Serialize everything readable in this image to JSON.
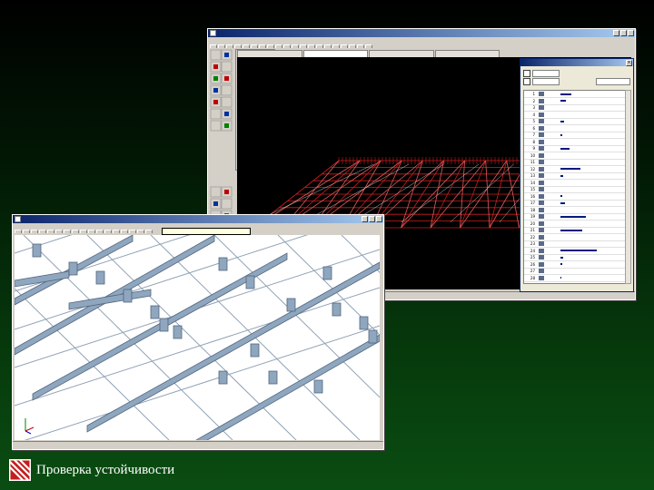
{
  "slide": {
    "caption": "Проверка устойчивости",
    "background_top": "#000000",
    "background_bottom": "#0a4d12",
    "logo_icon": "diagonal-stripes-logo"
  },
  "back_window": {
    "title": "",
    "tabs": [
      {
        "label": "",
        "active": false
      },
      {
        "label": "",
        "active": true
      },
      {
        "label": "",
        "active": false
      },
      {
        "label": "",
        "active": false
      }
    ],
    "status": "",
    "wireframe_color": "#cc1e1e",
    "dialog": {
      "title": "",
      "row_numbers": [
        "1",
        "2",
        "3",
        "4",
        "5",
        "6",
        "7",
        "8",
        "9",
        "10",
        "11",
        "12",
        "13",
        "14",
        "15",
        "16",
        "17",
        "18",
        "19",
        "20",
        "21",
        "22",
        "23",
        "24",
        "25",
        "26",
        "27",
        "28"
      ]
    }
  },
  "front_window": {
    "title": "",
    "tooltip": "",
    "status": "",
    "beam_color": "#8fa6bf",
    "axis_icon": "xyz-axis-icon"
  }
}
